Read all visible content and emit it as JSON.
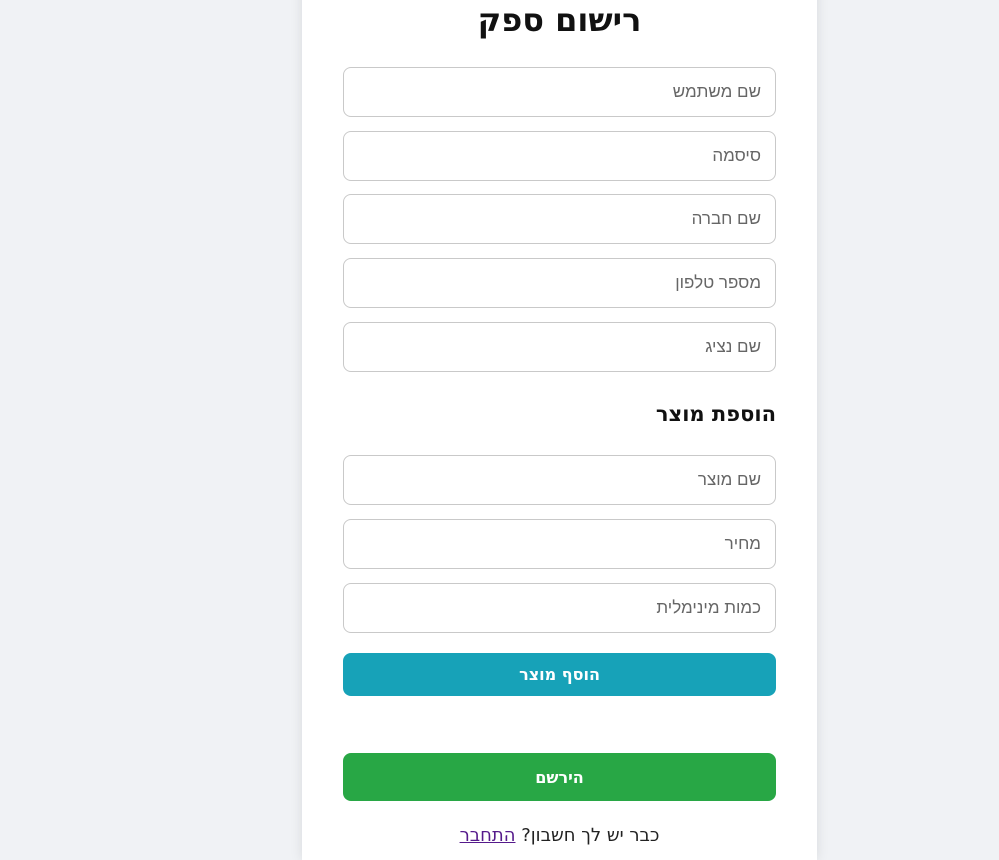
{
  "form": {
    "title": "רישום ספק",
    "fields": {
      "username_placeholder": "שם משתמש",
      "password_placeholder": "סיסמה",
      "company_placeholder": "שם חברה",
      "phone_placeholder": "מספר טלפון",
      "representative_placeholder": "שם נציג"
    }
  },
  "product": {
    "heading": "הוספת מוצר",
    "name_placeholder": "שם מוצר",
    "price_placeholder": "מחיר",
    "min_quantity_placeholder": "כמות מינימלית",
    "add_button_label": "הוסף מוצר"
  },
  "actions": {
    "register_label": "הירשם"
  },
  "login": {
    "prompt": "כבר יש לך חשבון?",
    "link_label": "התחבר"
  },
  "colors": {
    "page_background": "#f0f2f5",
    "add_button": "#17a2b8",
    "register_button": "#28a745",
    "link": "#551a8b"
  }
}
